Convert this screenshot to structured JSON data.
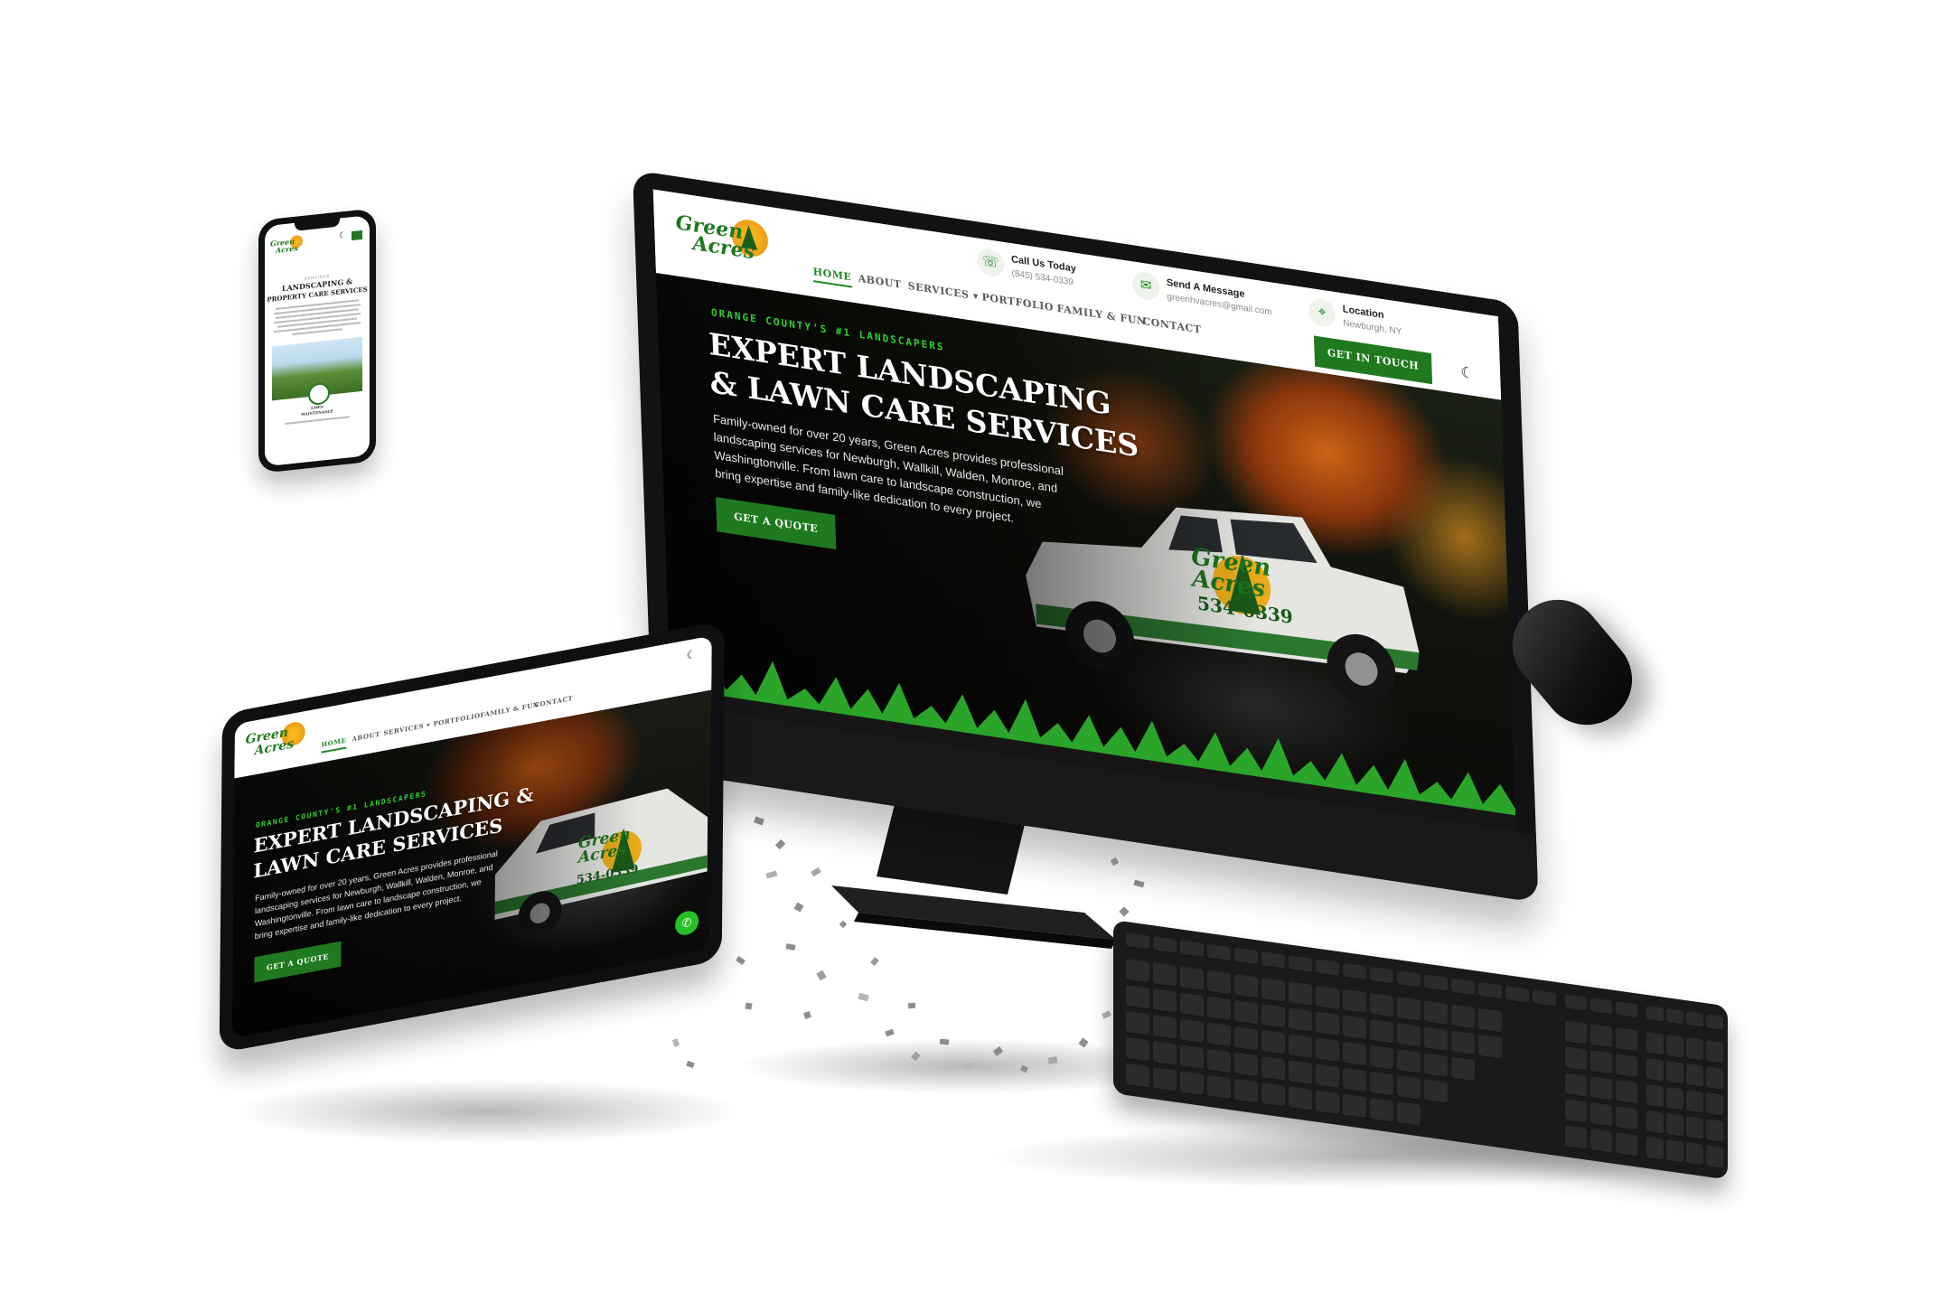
{
  "brand": {
    "logo_line1": "Green",
    "logo_line2": "Acres",
    "truck_phone": "534-0339"
  },
  "nav": {
    "home": "HOME",
    "about": "ABOUT",
    "services": "SERVICES",
    "portfolio": "PORTFOLIO",
    "family": "FAMILY & FUN",
    "contact": "CONTACT",
    "services_caret": "▾"
  },
  "contact_bar": {
    "call_title": "Call Us Today",
    "call_value": "(845) 534-0339",
    "message_title": "Send A Message",
    "message_value": "greenhvacres@gmail.com",
    "location_title": "Location",
    "location_value": "Newburgh, NY",
    "cta": "GET IN TOUCH",
    "phone_icon": "☏",
    "mail_icon": "✉",
    "pin_icon": "⌖",
    "moon_icon": "☾"
  },
  "hero": {
    "kicker": "ORANGE COUNTY'S #1 LANDSCAPERS",
    "title_desktop_1": "EXPERT LANDSCAPING",
    "title_desktop_2": "& LAWN CARE SERVICES",
    "title_tablet_1": "EXPERT LANDSCAPING &",
    "title_tablet_2": "LAWN CARE SERVICES",
    "body_1": "Family-owned for over 20 years, Green Acres provides professional",
    "body_2": "landscaping services for Newburgh, Wallkill, Walden, Monroe, and",
    "body_3": "Washingtonville. From lawn care to landscape construction, we",
    "body_4": "bring expertise and family-like dedication to every project.",
    "cta": "GET A QUOTE"
  },
  "mobile": {
    "eyebrow": "SERVICES",
    "title_1": "LANDSCAPING &",
    "title_2": "PROPERTY CARE SERVICES",
    "card_label_1": "LAWN",
    "card_label_2": "MAINTENANCE"
  },
  "tablet": {
    "whatsapp_icon": "✆"
  },
  "colors": {
    "brand_green": "#1f7a1f",
    "accent_green": "#2fd12f",
    "autumn_orange": "#e26d16"
  }
}
